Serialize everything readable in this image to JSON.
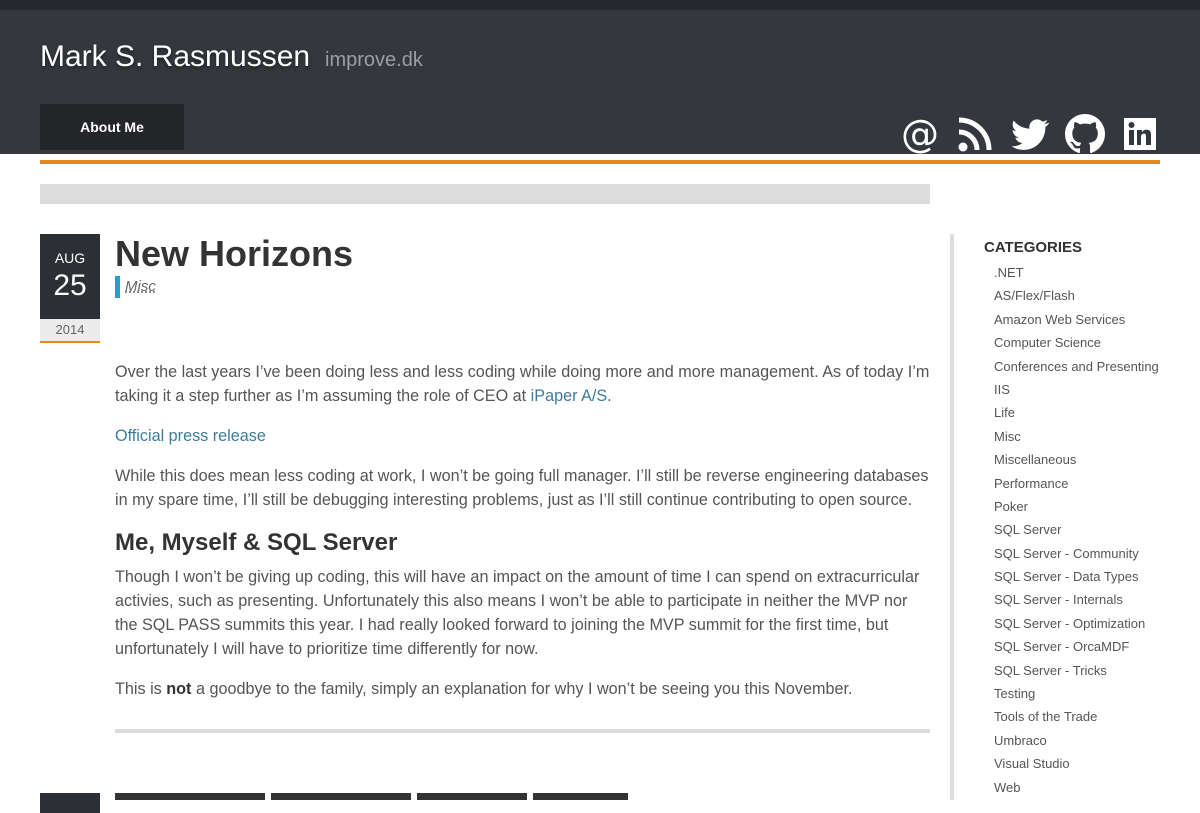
{
  "header": {
    "title": "Mark S. Rasmussen",
    "subtitle": "improve.dk",
    "nav": {
      "about": "About Me"
    },
    "social": [
      "at-icon",
      "rss-icon",
      "twitter-icon",
      "github-icon",
      "linkedin-icon"
    ],
    "accent_color": "#e8881a"
  },
  "post": {
    "date": {
      "month": "AUG",
      "day": "25",
      "year": "2014"
    },
    "title": "New Horizons",
    "category": "Misc",
    "p1_a": "Over the last years I’ve been doing less and less coding while doing more and more management. As of today I’m taking it a step further as I’m assuming the role of CEO at ",
    "p1_link": "iPaper A/S",
    "p1_b": ".",
    "p2_link": "Official press release",
    "p3": "While this does mean less coding at work, I won’t be going full manager. I’ll still be reverse engineering databases in my spare time, I’ll still be debugging interesting problems, just as I’ll still continue contributing to open source.",
    "h2": "Me, Myself & SQL Server",
    "p4": "Though I won’t be giving up coding, this will have an impact on the amount of time I can spend on extracurricular activies, such as presenting. Unfortunately this also means I won’t be able to participate in neither the MVP nor the SQL PASS summits this year. I had really looked forward to joining the MVP summit for the first time, but unfortunately I will have to prioritize time differently for now.",
    "p5_a": "This is ",
    "p5_bold": "not",
    "p5_b": " a goodbye to the family, simply an explanation for why I won’t be seeing you this November."
  },
  "sidebar": {
    "heading": "CATEGORIES",
    "categories": [
      ".NET",
      "AS/Flex/Flash",
      "Amazon Web Services",
      "Computer Science",
      "Conferences and Presenting",
      "IIS",
      "Life",
      "Misc",
      "Miscellaneous",
      "Performance",
      "Poker",
      "SQL Server",
      "SQL Server - Community",
      "SQL Server - Data Types",
      "SQL Server - Internals",
      "SQL Server - Optimization",
      "SQL Server - OrcaMDF",
      "SQL Server - Tricks",
      "Testing",
      "Tools of the Trade",
      "Umbraco",
      "Visual Studio",
      "Web"
    ]
  }
}
